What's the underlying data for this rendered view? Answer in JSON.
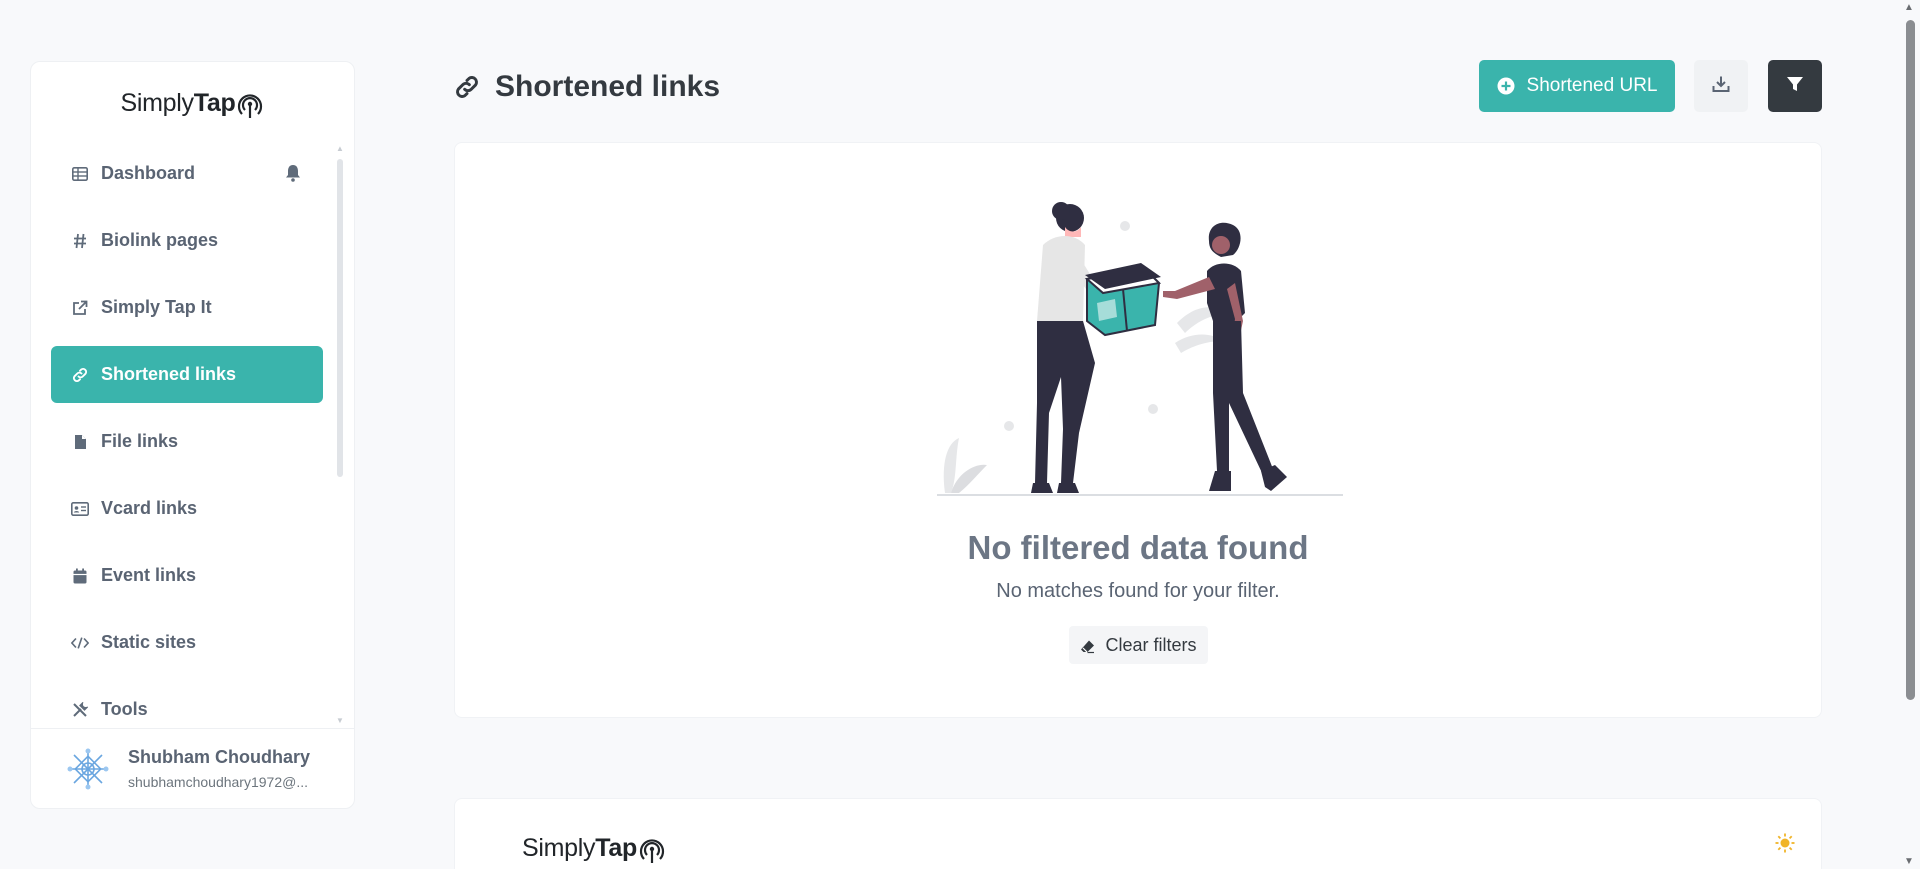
{
  "brand": {
    "light": "Simply",
    "bold": "Tap"
  },
  "sidebar": {
    "items": [
      {
        "label": "Dashboard",
        "icon": "table-grid-icon"
      },
      {
        "label": "Biolink pages",
        "icon": "hash-icon"
      },
      {
        "label": "Simply Tap It",
        "icon": "external-link-icon"
      },
      {
        "label": "Shortened links",
        "icon": "link-icon",
        "active": true
      },
      {
        "label": "File links",
        "icon": "file-icon"
      },
      {
        "label": "Vcard links",
        "icon": "id-card-icon"
      },
      {
        "label": "Event links",
        "icon": "calendar-icon"
      },
      {
        "label": "Static sites",
        "icon": "code-icon"
      },
      {
        "label": "Tools",
        "icon": "tools-icon"
      }
    ],
    "user": {
      "name": "Shubham Choudhary",
      "email": "shubhamchoudhary1972@..."
    }
  },
  "header": {
    "title": "Shortened links",
    "new_button": "Shortened URL"
  },
  "empty_state": {
    "title": "No filtered data found",
    "subtitle": "No matches found for your filter.",
    "clear_button": "Clear filters"
  },
  "colors": {
    "accent": "#3ab4ac",
    "dark": "#343a40",
    "sun": "#f0b429"
  }
}
